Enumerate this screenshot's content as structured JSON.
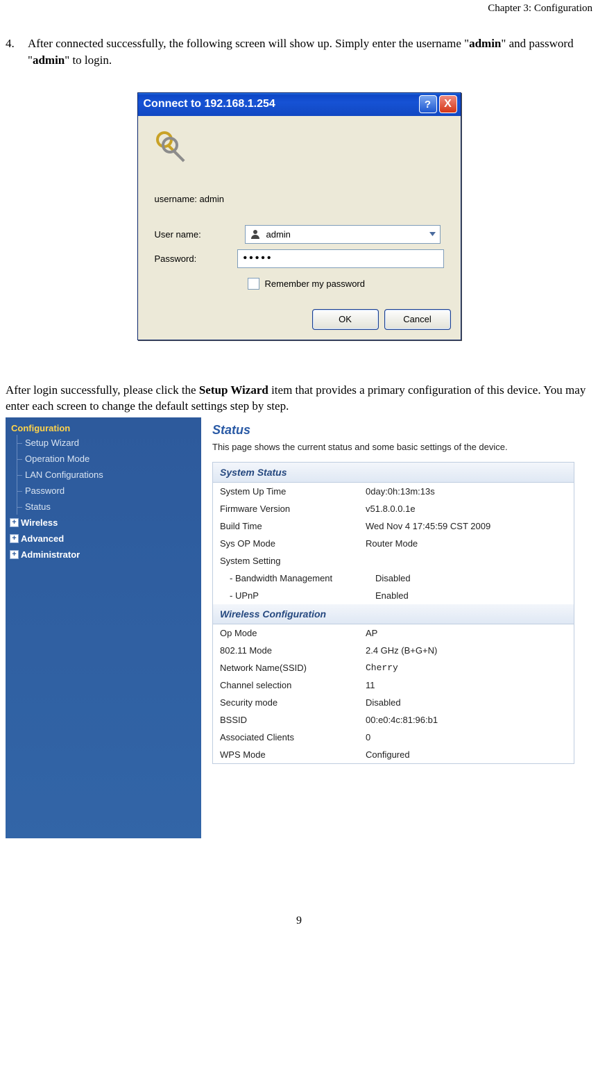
{
  "header": "Chapter 3: Configuration",
  "step": {
    "num": "4.",
    "pre": "After connected successfully, the following screen will show up. Simply enter the username \"",
    "b1": "admin",
    "mid": "\" and password \"",
    "b2": "admin",
    "post": "\" to login."
  },
  "dialog": {
    "title": "Connect to 192.168.1.254",
    "help": "?",
    "close": "X",
    "info": "username: admin",
    "user_label": "User name:",
    "user_value": "admin",
    "pass_label": "Password:",
    "pass_value": "•••••",
    "remember": "Remember my password",
    "ok": "OK",
    "cancel": "Cancel"
  },
  "para2": {
    "pre": "After login successfully, please click the ",
    "b": "Setup Wizard",
    "post": " item that provides a primary configuration of this device. You may enter each screen to change the default settings step by step."
  },
  "router": {
    "config_hdr": "Configuration",
    "items": [
      "Setup Wizard",
      "Operation Mode",
      "LAN Configurations",
      "Password",
      "Status"
    ],
    "sections": [
      "Wireless",
      "Advanced",
      "Administrator"
    ],
    "status_title": "Status",
    "status_desc": "This page shows the current status and some basic settings of the device.",
    "panel1": "System Status",
    "sys": [
      {
        "k": "System Up Time",
        "v": "0day:0h:13m:13s"
      },
      {
        "k": "Firmware Version",
        "v": "v51.8.0.0.1e"
      },
      {
        "k": "Build Time",
        "v": "Wed Nov 4 17:45:59 CST 2009"
      },
      {
        "k": "Sys OP Mode",
        "v": "Router Mode"
      },
      {
        "k": "System Setting",
        "v": ""
      }
    ],
    "sys_sub": [
      {
        "k": "- Bandwidth Management",
        "v": "Disabled"
      },
      {
        "k": "- UPnP",
        "v": "Enabled"
      }
    ],
    "panel2": "Wireless Configuration",
    "wifi": [
      {
        "k": "Op Mode",
        "v": "AP"
      },
      {
        "k": "802.11 Mode",
        "v": "2.4 GHz (B+G+N)"
      },
      {
        "k": "Network Name(SSID)",
        "v": "Cherry",
        "mono": true
      },
      {
        "k": "Channel selection",
        "v": "11"
      },
      {
        "k": "Security mode",
        "v": "Disabled"
      },
      {
        "k": "BSSID",
        "v": "00:e0:4c:81:96:b1"
      },
      {
        "k": "Associated Clients",
        "v": "0"
      },
      {
        "k": "WPS Mode",
        "v": "Configured"
      }
    ]
  },
  "page_num": "9"
}
